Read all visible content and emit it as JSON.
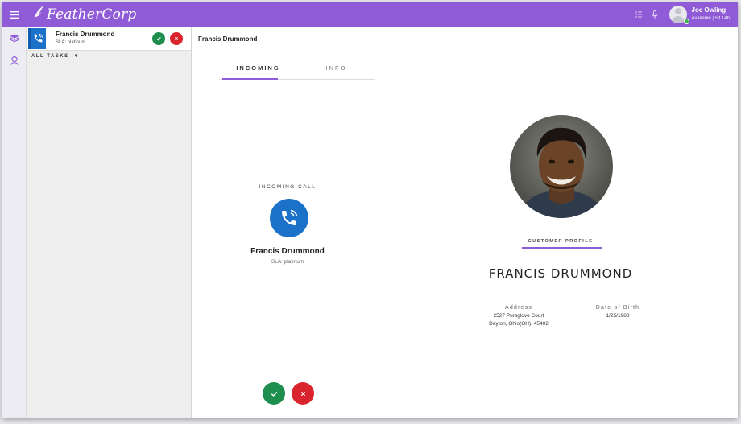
{
  "app": {
    "brand": "FeatherCorp",
    "user_name": "Joe Owling",
    "user_status": "Available | 5d 14h",
    "accent_color": "#8f5bd6"
  },
  "tasks": {
    "items": [
      {
        "name": "Francis Drummond",
        "sla": "SLA: platinum"
      }
    ],
    "filter_label": "ALL TASKS"
  },
  "task_panel": {
    "header": "Francis Drummond",
    "tabs": [
      {
        "label": "INCOMING",
        "active": true
      },
      {
        "label": "INFO",
        "active": false
      }
    ],
    "incoming_label": "INCOMING CALL",
    "caller_name": "Francis Drummond",
    "caller_sla": "SLA: platinum"
  },
  "profile": {
    "section_label": "CUSTOMER PROFILE",
    "name": "FRANCIS DRUMMOND",
    "address_label": "Address",
    "address_line1": "2527 Pursglove Court",
    "address_line2": "Dayton, Ohio(OH), 45402",
    "dob_label": "Date of Birth",
    "dob": "1/25/1988"
  },
  "icons": {
    "menu": "hamburger-icon",
    "logo": "feather-icon",
    "dialpad": "dialpad-icon",
    "mic": "microphone-icon",
    "layers": "layers-icon",
    "agent": "agent-icon",
    "phone": "phone-ringing-icon",
    "accept": "check-icon",
    "reject": "close-icon"
  }
}
